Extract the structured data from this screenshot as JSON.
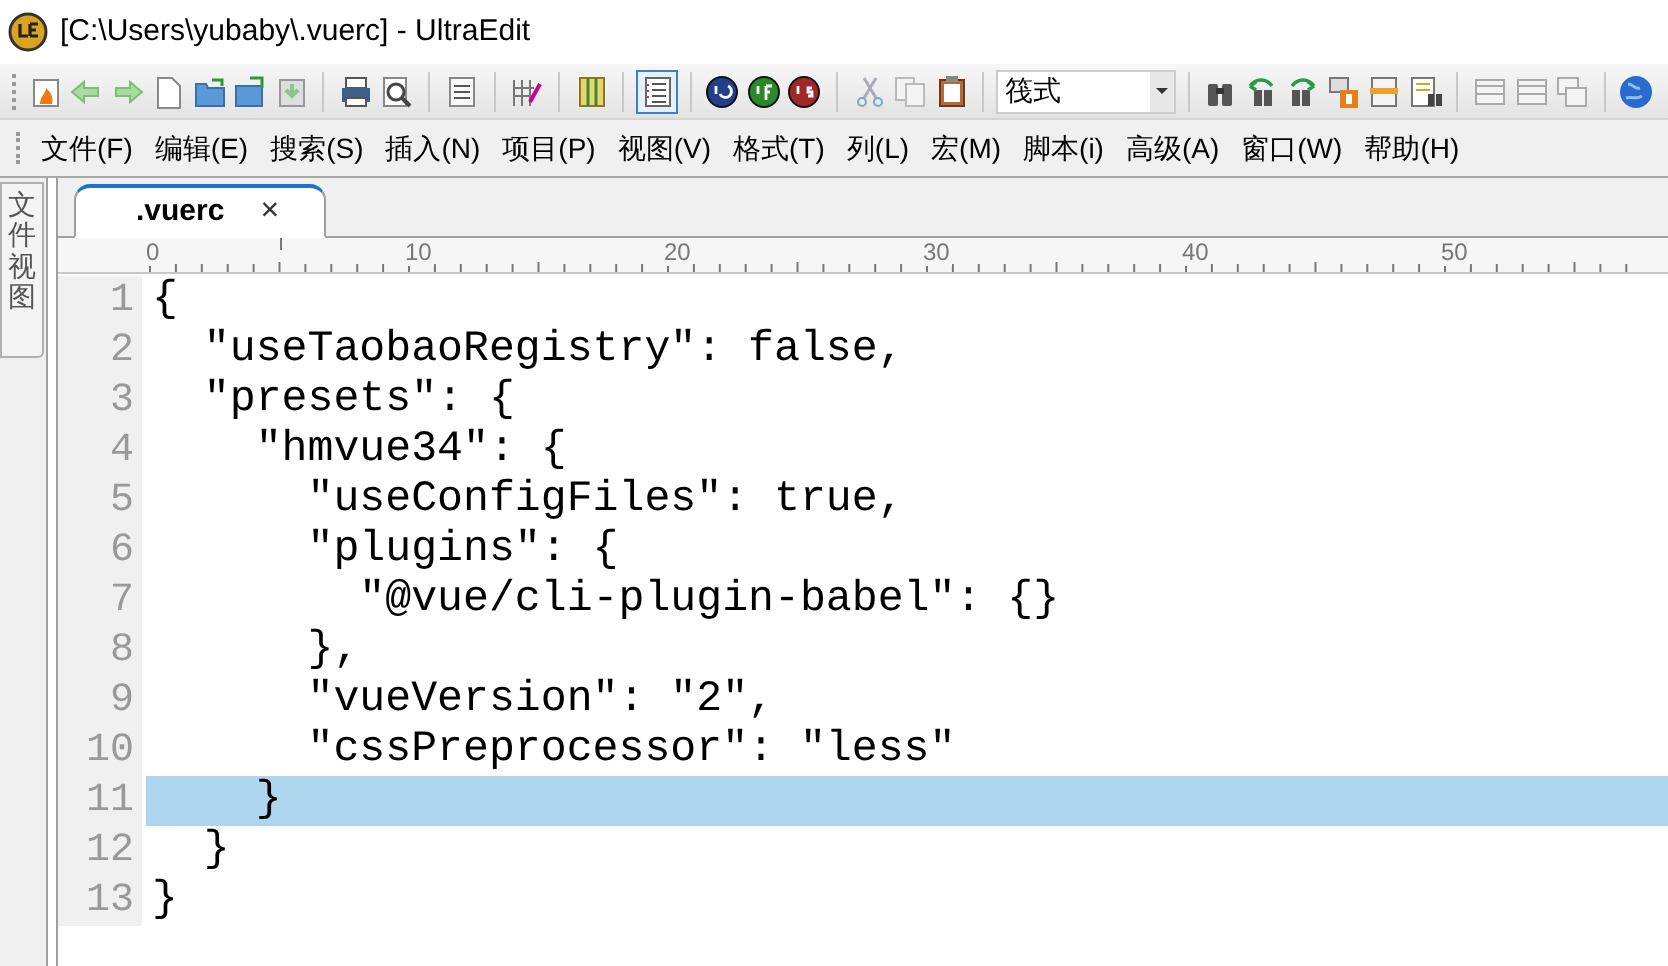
{
  "window": {
    "title": "[C:\\Users\\yubaby\\.vuerc] - UltraEdit"
  },
  "toolbar": [
    {
      "kind": "new"
    },
    {
      "kind": "back"
    },
    {
      "kind": "forward"
    },
    {
      "kind": "page"
    },
    {
      "kind": "open"
    },
    {
      "kind": "folder"
    },
    {
      "kind": "save"
    },
    {
      "kind": "sep"
    },
    {
      "kind": "print"
    },
    {
      "kind": "preview"
    },
    {
      "kind": "sep"
    },
    {
      "kind": "lines"
    },
    {
      "kind": "sep"
    },
    {
      "kind": "grid"
    },
    {
      "kind": "sep"
    },
    {
      "kind": "columns"
    },
    {
      "kind": "sep"
    },
    {
      "kind": "list",
      "pressed": true
    },
    {
      "kind": "sep"
    },
    {
      "kind": "ball-blue"
    },
    {
      "kind": "ball-green"
    },
    {
      "kind": "ball-red"
    },
    {
      "kind": "sep"
    },
    {
      "kind": "cut"
    },
    {
      "kind": "copy"
    },
    {
      "kind": "paste"
    },
    {
      "kind": "sep"
    },
    {
      "kind": "combo",
      "value": "筏式"
    },
    {
      "kind": "sep"
    },
    {
      "kind": "find"
    },
    {
      "kind": "find-prev"
    },
    {
      "kind": "find-next"
    },
    {
      "kind": "bookmark"
    },
    {
      "kind": "bar"
    },
    {
      "kind": "find-list"
    },
    {
      "kind": "sep"
    },
    {
      "kind": "win"
    },
    {
      "kind": "win"
    },
    {
      "kind": "win-stack"
    },
    {
      "kind": "sep"
    },
    {
      "kind": "globe"
    }
  ],
  "menu": [
    "文件(F)",
    "编辑(E)",
    "搜索(S)",
    "插入(N)",
    "项目(P)",
    "视图(V)",
    "格式(T)",
    "列(L)",
    "宏(M)",
    "脚本(i)",
    "高级(A)",
    "窗口(W)",
    "帮助(H)"
  ],
  "side_panel": {
    "tab": "文件视图"
  },
  "tabs": [
    {
      "label": ".vuerc",
      "selected": true,
      "close": "×"
    }
  ],
  "ruler": [
    "0",
    "10",
    "20",
    "30",
    "40",
    "50"
  ],
  "editor": {
    "lines": [
      {
        "number": "1",
        "text": "{",
        "current": false
      },
      {
        "number": "2",
        "text": "  \"useTaobaoRegistry\": false,",
        "current": false
      },
      {
        "number": "3",
        "text": "  \"presets\": {",
        "current": false
      },
      {
        "number": "4",
        "text": "    \"hmvue34\": {",
        "current": false
      },
      {
        "number": "5",
        "text": "      \"useConfigFiles\": true,",
        "current": false
      },
      {
        "number": "6",
        "text": "      \"plugins\": {",
        "current": false
      },
      {
        "number": "7",
        "text": "        \"@vue/cli-plugin-babel\": {}",
        "current": false
      },
      {
        "number": "8",
        "text": "      },",
        "current": false
      },
      {
        "number": "9",
        "text": "      \"vueVersion\": \"2\",",
        "current": false
      },
      {
        "number": "10",
        "text": "      \"cssPreprocessor\": \"less\"",
        "current": false
      },
      {
        "number": "11",
        "text": "    }",
        "current": true
      },
      {
        "number": "12",
        "text": "  }",
        "current": false
      },
      {
        "number": "13",
        "text": "}",
        "current": false
      }
    ]
  }
}
